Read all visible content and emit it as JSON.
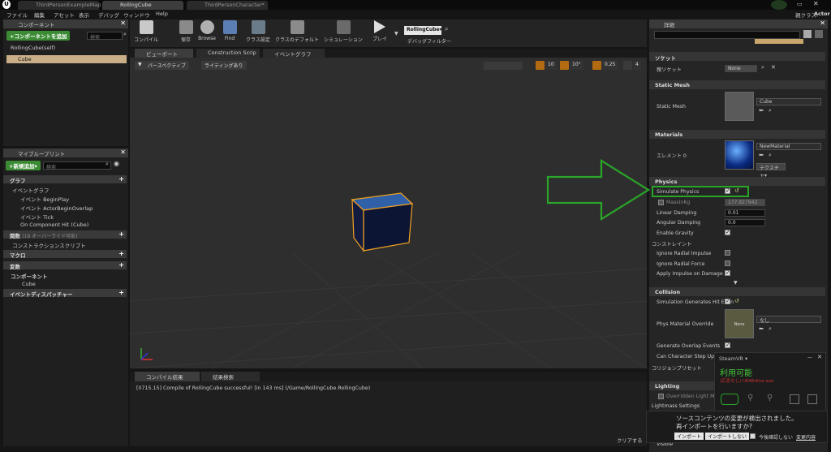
{
  "title_tabs": [
    "ThirdPersonExampleMap",
    "RollingCube",
    "ThirdPersonCharacter*"
  ],
  "parent_class_label": "親クラス:",
  "parent_class_value": "Actor",
  "menu": [
    "ファイル",
    "編集",
    "アセット",
    "表示",
    "デバッグ",
    "ウィンドウ",
    "Help"
  ],
  "components_panel": {
    "tab": "コンポーネント",
    "add_button": "+コンポーネントを追加",
    "search_placeholder": "検索",
    "items": [
      "RollingCube(self)",
      "Cube"
    ]
  },
  "toolbar": [
    "コンパイル",
    "保存",
    "Browse",
    "Find",
    "クラス設定",
    "クラスのデフォルト",
    "シミュレーション",
    "プレイ"
  ],
  "debug_target": "RollingCube▾",
  "debug_filter": "デバッグフィルター",
  "editor_tabs": [
    "ビューポート",
    "Construction Scrip",
    "イベントグラフ"
  ],
  "viewport": {
    "perspective": "パースペクティブ",
    "lighting": "ライティングあり",
    "grid": "10",
    "angle": "10°",
    "scale": "0.25",
    "camera_speed": "4"
  },
  "blueprint_panel": {
    "tab": "マイブループリント",
    "add_button": "+新規追加▾",
    "search_placeholder": "検索",
    "graph_section": "グラフ",
    "event_graph": "イベントグラフ",
    "events": [
      "イベント BeginPlay",
      "イベント ActorBeginOverlap",
      "イベント Tick",
      "On Component Hit (Cube)"
    ],
    "functions_section": "関数",
    "functions_note": "(18 オーバーライド可能)",
    "construction_script": "コンストラクションスクリプト",
    "macros_section": "マクロ",
    "variables_section": "変数",
    "components_section": "コンポーネント",
    "components_item": "Cube",
    "dispatchers_section": "イベントディスパッチャー"
  },
  "output_tabs": [
    "コンパイル結果",
    "結果検索"
  ],
  "output_log": "[0715.15] Compile of RollingCube successful! [in 143 ms] (/Game/RollingCube.RollingCube)",
  "clear_button": "クリアする",
  "details": {
    "tab": "詳細",
    "socket_section": "ソケット",
    "parent_socket_label": "親ソケット",
    "parent_socket_value": "None",
    "static_mesh_section": "Static Mesh",
    "static_mesh_label": "Static Mesh",
    "static_mesh_value": "Cube",
    "materials_section": "Materials",
    "element_label": "エレメント 0",
    "material_value": "NewMaterial",
    "texture_button": "テクスチャ▾",
    "physics_section": "Physics",
    "simulate_physics": "Simulate Physics",
    "mass_label": "MassInKg",
    "mass_value": "177.827942",
    "linear_damping_label": "Linear Damping",
    "linear_damping_value": "0.01",
    "angular_damping_label": "Angular Damping",
    "angular_damping_value": "0.0",
    "enable_gravity": "Enable Gravity",
    "constraints": "コンストレイント",
    "ignore_radial_impulse": "Ignore Radial Impulse",
    "ignore_radial_force": "Ignore Radial Force",
    "apply_impulse": "Apply Impulse on Damage",
    "collision_section": "Collision",
    "sim_hit_events": "Simulation Generates Hit Even",
    "phys_material_label": "Phys Material Override",
    "phys_material_thumb": "None",
    "phys_material_value": "なし",
    "gen_overlap": "Generate Overlap Events",
    "char_step": "Can Character Step Up On",
    "collision_preset": "コリジョンプリセット",
    "lighting_section": "Lighting",
    "override_lightmap": "Overridden Light Map R",
    "lightmass": "Lightmass Settings",
    "visible": "Visible"
  },
  "steamvr": {
    "title": "SteamVR ▾",
    "status": "利用可能",
    "sub": "(応答なし) UE4Editor.exe"
  },
  "notification": {
    "line1": "ソースコンテンツの変更が検出されました。",
    "line2": "再インポートを行いますか?",
    "import": "インポート",
    "no_import": "インポートしない",
    "dont_ask": "今後確認しない",
    "changes": "変更内容"
  },
  "colors": {
    "accent_green": "#2aa52a",
    "asset_orange": "#b36b11",
    "selection": "#c9ae88"
  }
}
